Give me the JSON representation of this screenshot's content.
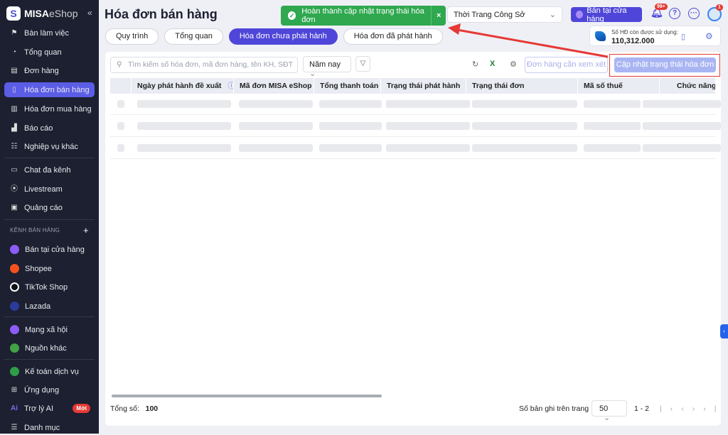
{
  "sidebar": {
    "brand": "MISA",
    "brand_suffix": "eShop",
    "collapse": "«",
    "items": [
      {
        "label": "Bàn làm việc",
        "icon": "flag-icon"
      },
      {
        "label": "Tổng quan",
        "icon": "gauge-icon"
      },
      {
        "label": "Đơn hàng",
        "icon": "order-icon"
      },
      {
        "label": "Hóa đơn bán hàng",
        "icon": "invoice-icon"
      },
      {
        "label": "Hóa đơn mua hàng",
        "icon": "purchase-invoice-icon"
      },
      {
        "label": "Báo cáo",
        "icon": "chart-icon"
      },
      {
        "label": "Nghiệp vụ khác",
        "icon": "list-icon"
      }
    ],
    "items2": [
      {
        "label": "Chat đa kênh"
      },
      {
        "label": "Livestream"
      },
      {
        "label": "Quảng cáo"
      }
    ],
    "section": "KÊNH BÁN HÀNG",
    "channels": [
      {
        "label": "Bán tại cửa hàng",
        "color": "#8b5cf6"
      },
      {
        "label": "Shopee",
        "color": "#f4511e"
      },
      {
        "label": "TikTok Shop",
        "color": "#111111"
      },
      {
        "label": "Lazada",
        "color": "#1e3a8a"
      }
    ],
    "social": [
      {
        "label": "Mạng xã hội",
        "color": "#8b5cf6"
      },
      {
        "label": "Nguồn khác",
        "color": "#43a047"
      }
    ],
    "bottom": [
      {
        "label": "Kế toán dịch vụ"
      },
      {
        "label": "Ứng dụng"
      },
      {
        "label": "Trợ lý AI",
        "badge": "Mới"
      },
      {
        "label": "Danh mục"
      }
    ]
  },
  "header": {
    "title": "Hóa đơn bán hàng",
    "toast": "Hoàn thành cập nhật trạng thái hóa đơn",
    "shop": "Thời Trang Công Sở",
    "store_btn": "Bán tại cửa hàng",
    "notif_badge": "99+",
    "avatar_badge": "1"
  },
  "quota": {
    "label": "Số HĐ còn được sử dụng:",
    "value": "110,312.000"
  },
  "tabs": [
    "Quy trình",
    "Tổng quan",
    "Hóa đơn chưa phát hành",
    "Hóa đơn đã phát hành"
  ],
  "toolbar": {
    "search_placeholder": "Tìm kiếm số hóa đơn, mã đơn hàng, tên KH, SĐT",
    "period": "Năm nay",
    "review": "Đơn hàng cần xem xét",
    "update": "Cập nhật trạng thái hóa đơn"
  },
  "table": {
    "columns": [
      "Ngày phát hành đề xuất",
      "Mã đơn MISA eShop",
      "Tổng thanh toán",
      "Trạng thái phát hành",
      "Trạng thái đơn",
      "Mã số thuế",
      "Chức năng"
    ]
  },
  "footer": {
    "total_label": "Tổng số:",
    "total": "100",
    "per_page_label": "Số bản ghi trên trang",
    "per_page": "50",
    "range": "1 - 2"
  }
}
